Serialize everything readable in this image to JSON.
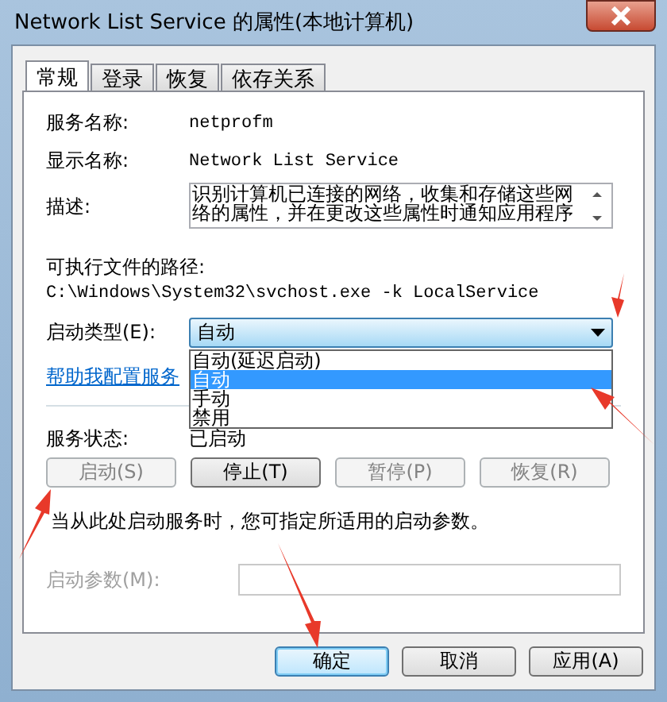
{
  "window": {
    "title": "Network List Service 的属性(本地计算机)"
  },
  "tabs": [
    {
      "label": "常规",
      "selected": true
    },
    {
      "label": "登录",
      "selected": false
    },
    {
      "label": "恢复",
      "selected": false
    },
    {
      "label": "依存关系",
      "selected": false
    }
  ],
  "service_name": {
    "label": "服务名称:",
    "value": "netprofm"
  },
  "display_name": {
    "label": "显示名称:",
    "value": "Network List Service"
  },
  "description": {
    "label": "描述:",
    "value": "识别计算机已连接的网络，收集和存储这些网络的属性，并在更改这些属性时通知应用程序"
  },
  "executable_path": {
    "label": "可执行文件的路径:",
    "value": "C:\\Windows\\System32\\svchost.exe -k LocalService"
  },
  "startup_type": {
    "label": "启动类型(E):",
    "value": "自动",
    "expanded": true,
    "options": [
      {
        "label": "自动(延迟启动)",
        "selected": false
      },
      {
        "label": "自动",
        "selected": true
      },
      {
        "label": "手动",
        "selected": false
      },
      {
        "label": "禁用",
        "selected": false
      }
    ]
  },
  "help_link": "帮助我配置服务",
  "service_status": {
    "label": "服务状态:",
    "value": "已启动"
  },
  "service_buttons": [
    {
      "label": "启动(S)",
      "disabled": true
    },
    {
      "label": "停止(T)",
      "disabled": false
    },
    {
      "label": "暂停(P)",
      "disabled": true
    },
    {
      "label": "恢复(R)",
      "disabled": true
    }
  ],
  "hint": "当从此处启动服务时，您可指定所适用的启动参数。",
  "start_parameters": {
    "label": "启动参数(M):",
    "disabled": true
  },
  "dialog_buttons": [
    {
      "label": "确定",
      "default": true
    },
    {
      "label": "取消",
      "default": false
    },
    {
      "label": "应用(A)",
      "default": false
    }
  ]
}
